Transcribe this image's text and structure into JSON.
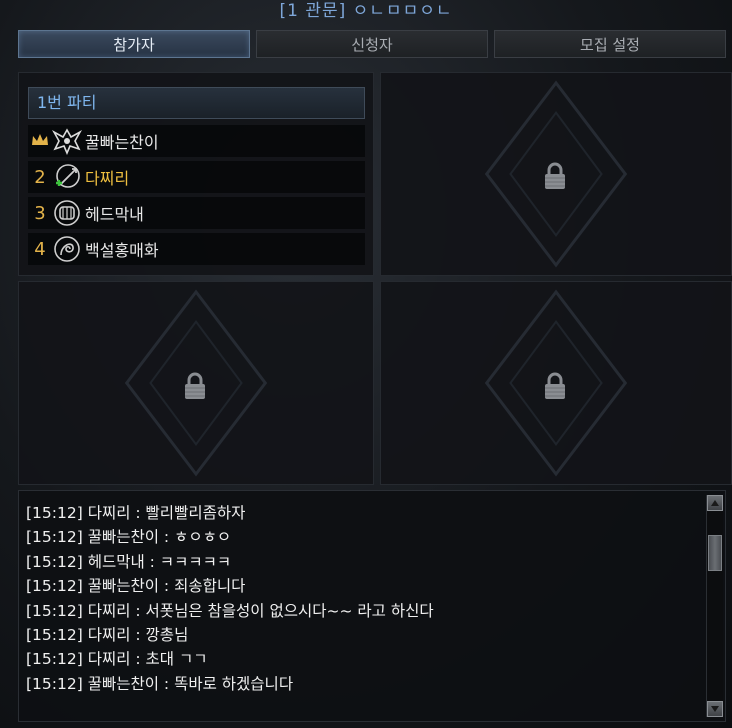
{
  "window": {
    "title": "[1 관문] ㅇㄴㅁㅁㅇㄴ"
  },
  "tabs": [
    {
      "label": "참가자",
      "active": true
    },
    {
      "label": "신청자",
      "active": false
    },
    {
      "label": "모집 설정",
      "active": false
    }
  ],
  "party1": {
    "header": "1번 파티",
    "members": [
      {
        "slot": "",
        "leader": true,
        "class_icon": "class-emblem-icon",
        "name": "꿀빠는찬이"
      },
      {
        "slot": "2",
        "leader": false,
        "class_icon": "class-emblem-icon",
        "name": "다찌리",
        "self": true
      },
      {
        "slot": "3",
        "leader": false,
        "class_icon": "class-emblem-icon",
        "name": "헤드막내"
      },
      {
        "slot": "4",
        "leader": false,
        "class_icon": "class-emblem-icon",
        "name": "백설홍매화"
      }
    ]
  },
  "locked_parties": [
    {
      "icon": "lock-icon"
    },
    {
      "icon": "lock-icon"
    },
    {
      "icon": "lock-icon"
    }
  ],
  "chat": {
    "lines": [
      "[15:12] 다찌리 : 빨리빨리좀하자",
      "[15:12] 꿀빠는찬이 : ㅎㅇㅎㅇ",
      "[15:12] 헤드막내 : ㅋㅋㅋㅋㅋ",
      "[15:12] 꿀빠는찬이 : 죄송합니다",
      "[15:12] 다찌리 : 서폿님은 참을성이 없으시다~~ 라고 하신다",
      "[15:12] 다찌리 : 깡총님",
      "[15:12] 다찌리 : 초대 ㄱㄱ",
      "[15:12] 꿀빠는찬이 : 똑바로 하겠습니다"
    ]
  },
  "colors": {
    "accent_blue": "#7fb6ee",
    "self_name": "#f0c040",
    "slot_number": "#e3b34a",
    "leader_crown": "#e3b34a",
    "add_plus": "#3cc43c"
  }
}
